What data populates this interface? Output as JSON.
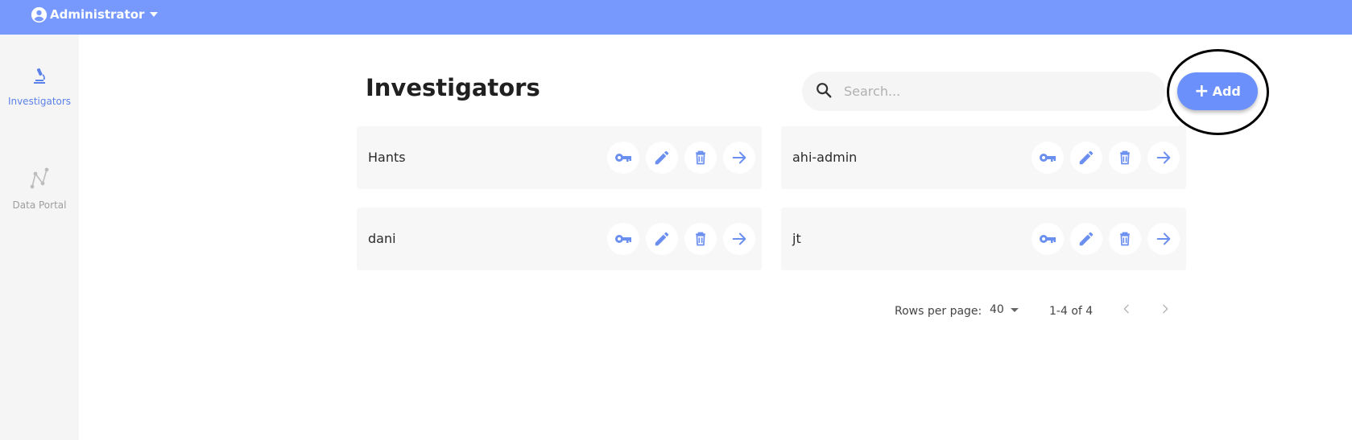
{
  "header": {
    "user_name": "Administrator",
    "accent_color": "#7799fd"
  },
  "sidebar": {
    "items": [
      {
        "label": "Investigators",
        "icon": "microscope-icon",
        "active": true
      },
      {
        "label": "Data Portal",
        "icon": "network-graph-icon",
        "active": false
      }
    ]
  },
  "main": {
    "title": "Investigators",
    "search": {
      "placeholder": "Search...",
      "value": ""
    },
    "add_button_label": "Add",
    "cards": [
      {
        "name": "Hants"
      },
      {
        "name": "ahi-admin"
      },
      {
        "name": "dani"
      },
      {
        "name": "jt"
      }
    ],
    "card_actions": [
      "key-icon",
      "edit-pencil-icon",
      "delete-trash-icon",
      "arrow-right-icon"
    ]
  },
  "pagination": {
    "rows_label": "Rows per page:",
    "rows_value": "40",
    "range": "1-4 of 4"
  }
}
